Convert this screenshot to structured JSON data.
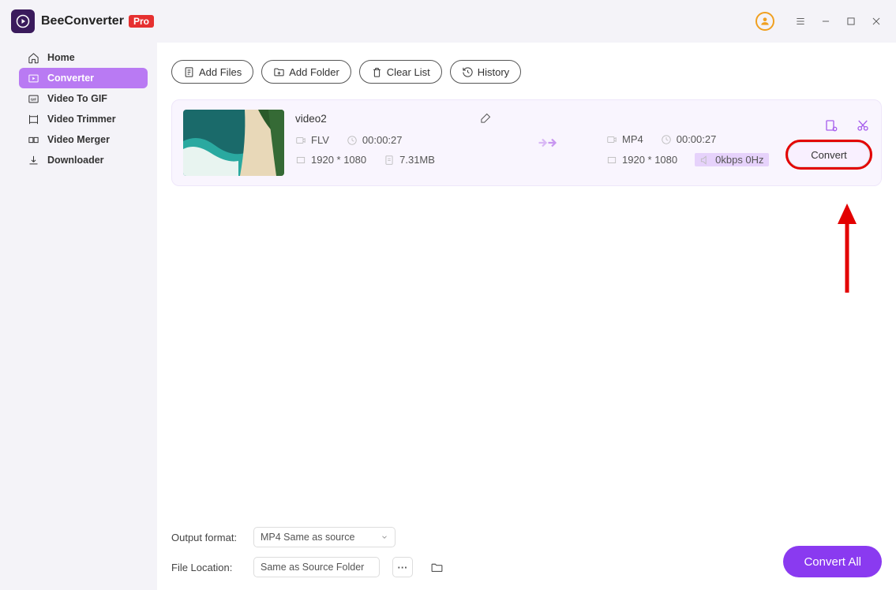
{
  "app": {
    "title": "BeeConverter",
    "badge": "Pro"
  },
  "sidebar": {
    "items": [
      {
        "label": "Home"
      },
      {
        "label": "Converter"
      },
      {
        "label": "Video To GIF"
      },
      {
        "label": "Video Trimmer"
      },
      {
        "label": "Video Merger"
      },
      {
        "label": "Downloader"
      }
    ]
  },
  "toolbar": {
    "add_files": "Add Files",
    "add_folder": "Add Folder",
    "clear_list": "Clear List",
    "history": "History"
  },
  "file": {
    "name": "video2",
    "src": {
      "format": "FLV",
      "duration": "00:00:27",
      "resolution": "1920 * 1080",
      "size": "7.31MB"
    },
    "dst": {
      "format": "MP4",
      "duration": "00:00:27",
      "resolution": "1920 * 1080",
      "audio": "0kbps 0Hz"
    },
    "convert_label": "Convert"
  },
  "bottom": {
    "output_format_label": "Output format:",
    "output_format_value": "MP4 Same as source",
    "file_location_label": "File Location:",
    "file_location_value": "Same as Source Folder",
    "more": "···",
    "convert_all": "Convert All"
  }
}
